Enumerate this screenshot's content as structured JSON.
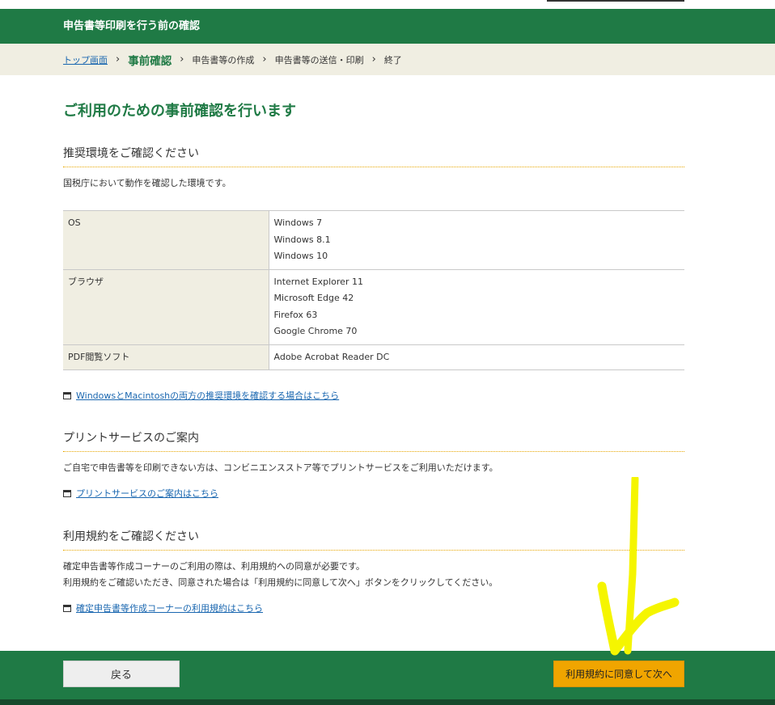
{
  "header": {
    "title": "申告書等印刷を行う前の確認"
  },
  "breadcrumb": {
    "top_link": "トップ画面",
    "sep": "›",
    "current": "事前確認",
    "steps": [
      "申告書等の作成",
      "申告書等の送信・印刷",
      "終了"
    ]
  },
  "page": {
    "title": "ご利用のための事前確認を行います"
  },
  "env": {
    "heading": "推奨環境をご確認ください",
    "description": "国税庁において動作を確認した環境です。",
    "rows": [
      {
        "label": "OS",
        "values": [
          "Windows 7",
          "Windows 8.1",
          "Windows 10"
        ]
      },
      {
        "label": "ブラウザ",
        "values": [
          "Internet Explorer 11",
          "Microsoft Edge 42",
          "Firefox 63",
          "Google Chrome 70"
        ]
      },
      {
        "label": "PDF閲覧ソフト",
        "values": [
          "Adobe Acrobat Reader DC"
        ]
      }
    ],
    "link": "WindowsとMacintoshの両方の推奨環境を確認する場合はこちら"
  },
  "print_service": {
    "heading": "プリントサービスのご案内",
    "description": "ご自宅で申告書等を印刷できない方は、コンビニエンスストア等でプリントサービスをご利用いただけます。",
    "link": "プリントサービスのご案内はこちら"
  },
  "terms": {
    "heading": "利用規約をご確認ください",
    "line1": "確定申告書等作成コーナーのご利用の際は、利用規約への同意が必要です。",
    "line2": "利用規約をご確認いただき、同意された場合は「利用規約に同意して次へ」ボタンをクリックしてください。",
    "link": "確定申告書等作成コーナーの利用規約はこちら"
  },
  "footer": {
    "back_label": "戻る",
    "next_label": "利用規約に同意して次へ"
  },
  "colors": {
    "brand_green": "#1f7a45",
    "accent_orange": "#f0a500",
    "annotation_yellow": "#f5f500"
  }
}
